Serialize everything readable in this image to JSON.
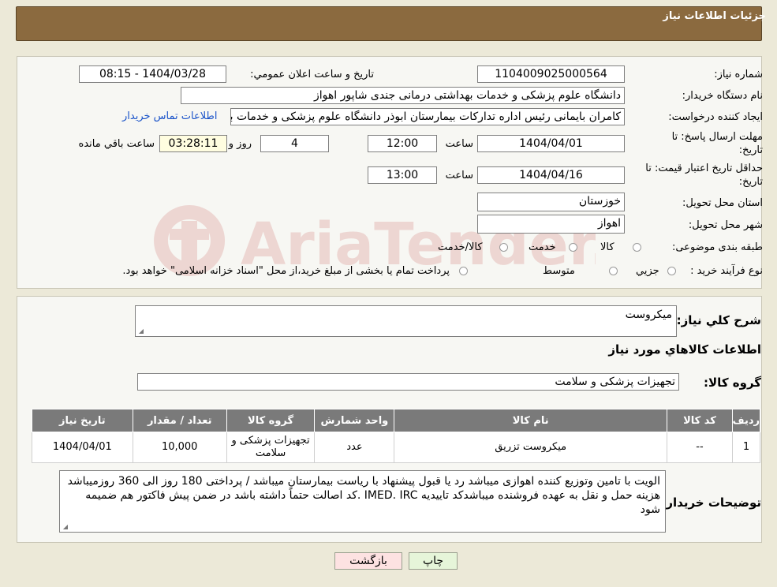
{
  "header": {
    "title": "جزئیات اطلاعات نیاز"
  },
  "form": {
    "need_number_label": "شماره نیاز:",
    "need_number": "1104009025000564",
    "announce_label": "تاريخ و ساعت اعلان عمومي:",
    "announce_value": "1404/03/28 - 08:15",
    "buyer_org_label": "نام دستگاه خريدار:",
    "buyer_org": "دانشگاه علوم پزشکی و خدمات بهداشتی درمانی جندی شاپور اهواز",
    "requester_label": "ايجاد کننده درخواست:",
    "requester": "کامران بایمانی رئیس اداره تدارکات بیمارستان ابوذر  دانشگاه علوم پزشکی و خدمات بهداشتی",
    "contact_link": "اطلاعات تماس خريدار",
    "deadline_label_1": "مهلت ارسال پاسخ: تا",
    "deadline_label_2": "تاريخ:",
    "deadline_date": "1404/04/01",
    "time_label": "ساعت",
    "deadline_time": "12:00",
    "days_value": "4",
    "days_label": "روز و",
    "remaining_value": "03:28:11",
    "remaining_label": "ساعت باقي مانده",
    "validity_label_1": "حداقل تاريخ اعتبار قيمت: تا",
    "validity_label_2": "تاريخ:",
    "validity_date": "1404/04/16",
    "validity_time": "13:00",
    "province_label": "استان محل تحويل:",
    "province": "خوزستان",
    "city_label": "شهر محل تحويل:",
    "city": "اهواز",
    "category_label": "طبقه بندی موضوعی:",
    "category_options": [
      "کالا",
      "خدمت",
      "کالا/خدمت"
    ],
    "process_label": "نوع فرآيند خريد :",
    "process_options": [
      "جزيي",
      "متوسط"
    ],
    "process_note": "پرداخت تمام یا بخشی از مبلغ خرید،از محل \"اسناد خزانه اسلامی\" خواهد بود."
  },
  "details": {
    "summary_label": "شرح كلي نياز:",
    "summary_value": "میکروست",
    "items_title": "اطلاعات كالاهاي مورد نياز",
    "group_label": "گروه كالا:",
    "group_value": "تجهیزات پزشکی و سلامت",
    "table": {
      "headers": [
        "رديف",
        "كد كالا",
        "نام كالا",
        "واحد شمارش",
        "گروه كالا",
        "تعداد / مقدار",
        "تاريخ نياز"
      ],
      "rows": [
        [
          "1",
          "--",
          "میکروست تزریق",
          "عدد",
          "تجهیزات پزشکی و سلامت",
          "10,000",
          "1404/04/01"
        ]
      ]
    },
    "buyer_notes_label": "توضيحات خريدار:",
    "buyer_notes": "الویت با تامین وتوزیع کننده اهوازی  میباشد رد یا قبول پیشنهاد با ریاست بیمارستان میباشد / پرداختی 180 روز الی 360 روزمیباشد هزینه حمل و نقل به عهده فروشنده میباشدکد تاییدیه IMED. IRC .کد اصالت حتماً داشته باشد در ضمن پیش فاکتور هم ضمیمه شود"
  },
  "buttons": {
    "print": "چاپ",
    "back": "بازگشت"
  },
  "watermark": {
    "text": "AriaTender.neT"
  },
  "colors": {
    "header_bg": "#8b6a3f",
    "link": "#1a53c9",
    "back_button_bg": "#fde2e2",
    "print_button_bg": "#e6f5d9"
  }
}
